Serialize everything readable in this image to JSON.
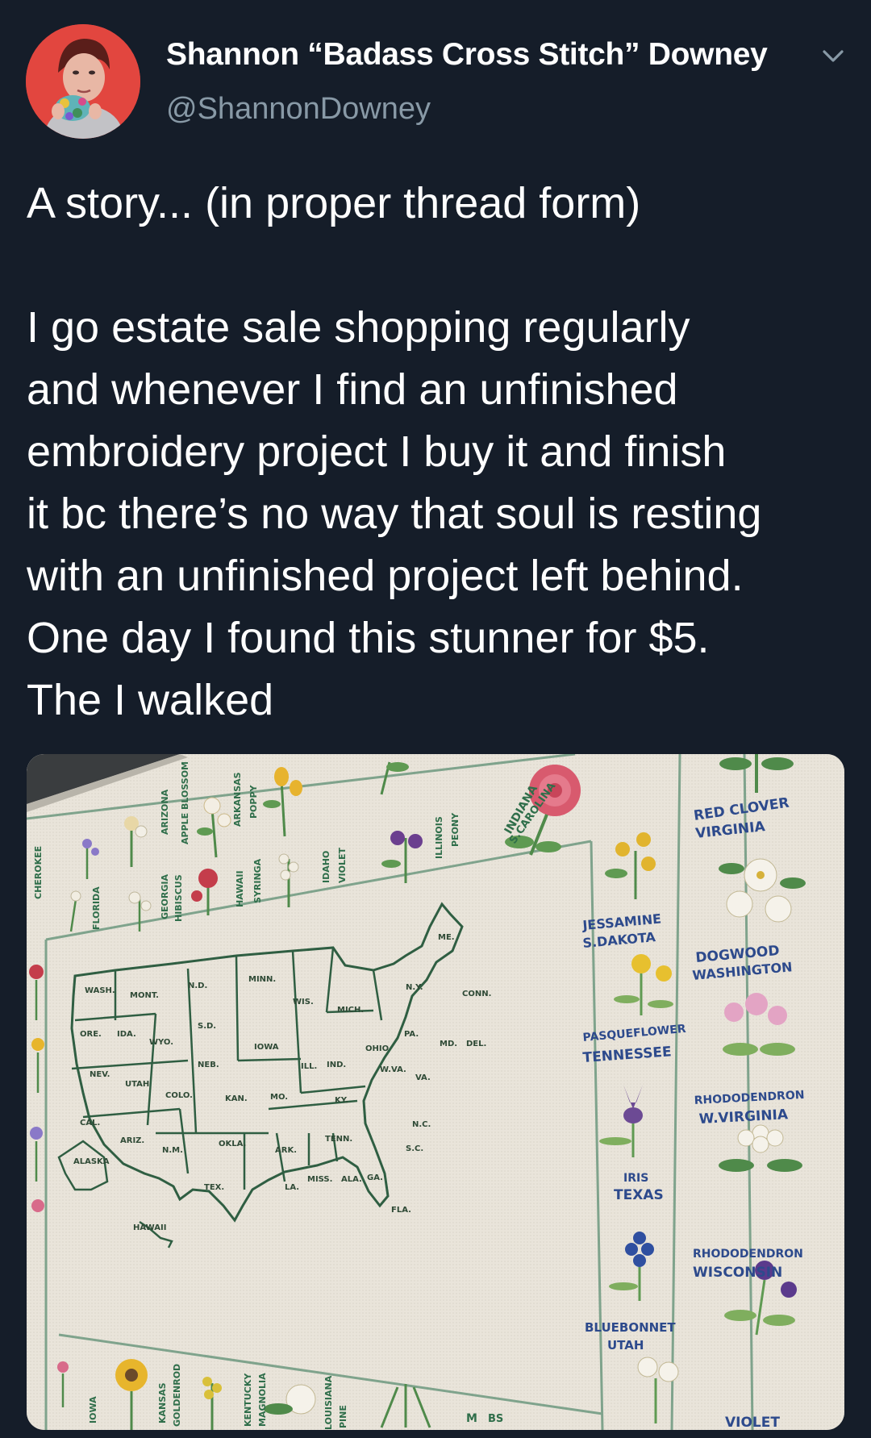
{
  "user": {
    "display_name": "Shannon “Badass Cross Stitch” Downey",
    "handle": "@ShannonDowney"
  },
  "icons": {
    "more": "chevron-down-icon"
  },
  "tweet": {
    "line1": "A story... (in proper thread form)",
    "body_lines": [
      "I go estate sale shopping regularly",
      "and whenever I find an unfinished",
      "embroidery project I buy it and finish",
      "it bc there’s no way that soul is resting",
      "with an unfinished project left behind.",
      "One day I found this stunner for $5.",
      "The I walked"
    ]
  },
  "photo": {
    "states": [
      "WASH.",
      "MONT.",
      "N.D.",
      "MINN.",
      "ORE.",
      "IDA.",
      "WYO.",
      "S.D.",
      "NEB.",
      "IOWA",
      "WIS.",
      "MICH.",
      "N.Y.",
      "ME.",
      "PA.",
      "OHIO",
      "ILL.",
      "IND.",
      "NEV.",
      "UTAH",
      "COLO.",
      "KAN.",
      "MO.",
      "KY.",
      "VA.",
      "W.VA.",
      "N.C.",
      "CAL.",
      "ARIZ.",
      "N.M.",
      "OKLA.",
      "ARK.",
      "TENN.",
      "S.C.",
      "TEX.",
      "LA.",
      "MISS.",
      "ALA.",
      "GA.",
      "FLA.",
      "ALASKA",
      "HAWAII",
      "MD.",
      "DEL.",
      "CONN."
    ],
    "right_labels": [
      "RED CLOVER",
      "VIRGINIA",
      "JESSAMINE",
      "S.DAKOTA",
      "DOGWOOD",
      "WASHINGTON",
      "PASQUEFLOWER",
      "TENNESSEE",
      "RHODODENDRON",
      "W.VIRGINIA",
      "IRIS",
      "TEXAS",
      "RHODODENDRON",
      "WISCONSIN",
      "BLUEBONNET",
      "UTAH",
      "VIOLET"
    ],
    "top_labels": [
      "ARIZONA",
      "APPLE BLOSSOM",
      "ARKANSAS",
      "POPPY",
      "SYRINGA",
      "IDAHO",
      "VIOLET",
      "ILLINOIS",
      "PEONY",
      "INDIANA",
      "S.CAROLINA",
      "GEORGIA",
      "HIBISCUS",
      "HAWAII",
      "FLORIDA",
      "CHEROKEE"
    ],
    "bottom_labels": [
      "IOWA",
      "KANSAS",
      "GOLDENROD",
      "KENTUCKY",
      "MAGNOLIA",
      "LOUISIANA",
      "PINE",
      "M",
      "BS"
    ]
  }
}
